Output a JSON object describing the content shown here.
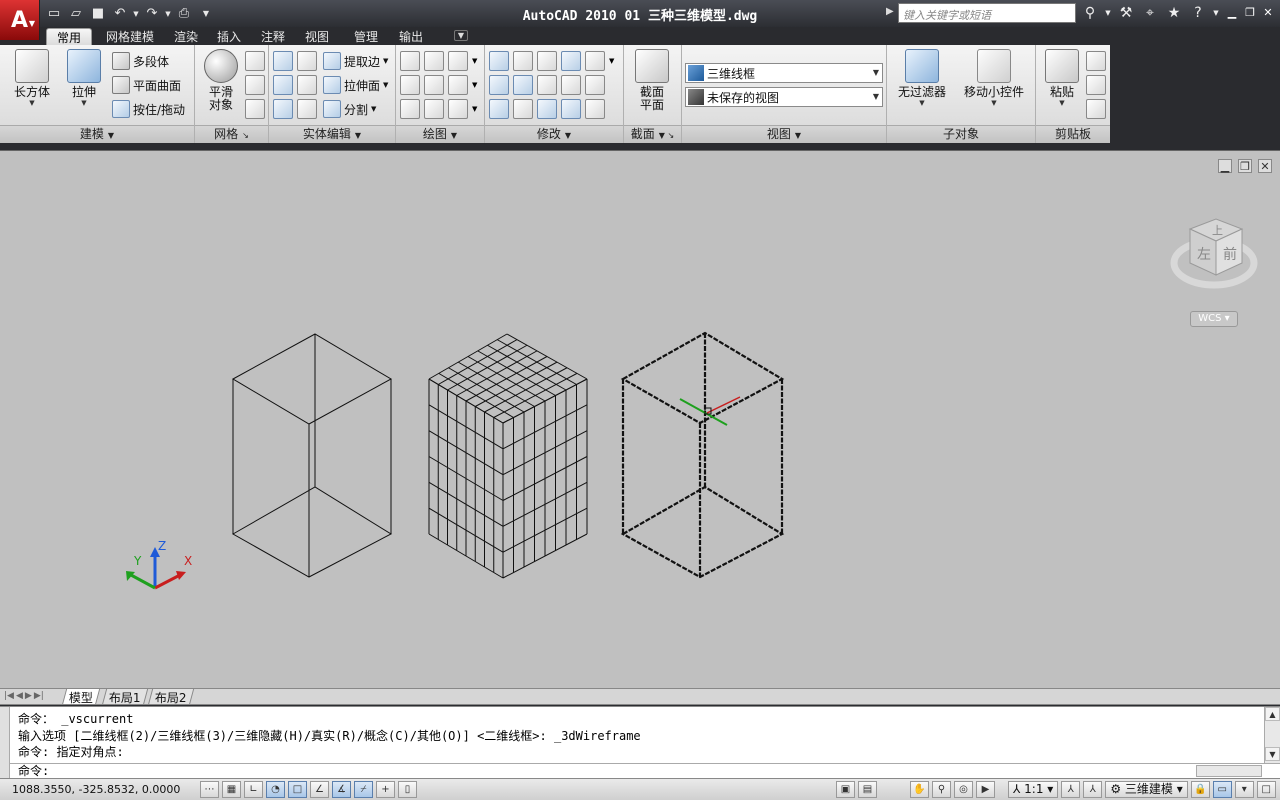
{
  "title_bar": {
    "title": "AutoCAD 2010   01 三种三维模型.dwg",
    "search_placeholder": "键入关键字或短语",
    "app_menu_icon": "autocad-logo-icon",
    "qat_icons": [
      "new-icon",
      "open-icon",
      "save-icon",
      "undo-icon",
      "redo-icon",
      "print-icon",
      "more-icon"
    ]
  },
  "ribbon_tabs": [
    "常用",
    "网格建模",
    "渲染",
    "插入",
    "注释",
    "视图",
    "管理",
    "输出"
  ],
  "panels": {
    "modeling": {
      "title": "建模",
      "box_label": "长方体",
      "extrude_label": "拉伸",
      "polysolid_label": "多段体",
      "planar_label": "平面曲面",
      "presspull_label": "按住/拖动"
    },
    "mesh": {
      "title": "网格",
      "smooth_label1": "平滑",
      "smooth_label2": "对象"
    },
    "solid_edit": {
      "title": "实体编辑",
      "extract_label": "提取边",
      "extrude_face_label": "拉伸面",
      "separate_label": "分割"
    },
    "draw": {
      "title": "绘图"
    },
    "modify": {
      "title": "修改"
    },
    "section": {
      "title": "截面",
      "plane_label1": "截面",
      "plane_label2": "平面"
    },
    "view": {
      "title": "视图",
      "visual_style": "三维线框",
      "saved_view": "未保存的视图"
    },
    "subobject": {
      "title": "子对象",
      "filter_label": "无过滤器",
      "gizmo_label": "移动小控件"
    },
    "clipboard": {
      "title": "剪贴板",
      "paste_label": "粘贴"
    }
  },
  "viewcube": {
    "top": "上",
    "left": "左",
    "front": "前",
    "wcs": "WCS"
  },
  "axes": {
    "x": "X",
    "y": "Y",
    "z": "Z"
  },
  "layout_tabs": [
    "模型",
    "布局1",
    "布局2"
  ],
  "command_lines": [
    "命令： _vscurrent",
    "输入选项 [二维线框(2)/三维线框(3)/三维隐藏(H)/真实(R)/概念(C)/其他(O)] <二维线框>: _3dWireframe",
    "命令: 指定对角点:"
  ],
  "command_prompt": "命令:",
  "status": {
    "coordinates": "1088.3550, -325.8532, 0.0000",
    "annotation_scale": "1:1",
    "workspace": "三维建模"
  },
  "colors": {
    "autocad_red": "#c81e1e",
    "ribbon_bg": "#e6e6e6",
    "canvas_bg": "#c0c0c0"
  }
}
